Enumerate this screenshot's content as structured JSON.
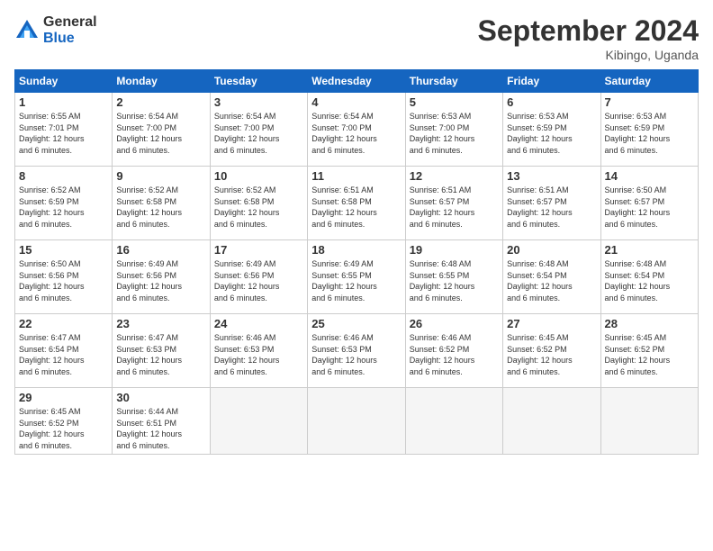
{
  "logo": {
    "general": "General",
    "blue": "Blue"
  },
  "title": "September 2024",
  "location": "Kibingo, Uganda",
  "days_of_week": [
    "Sunday",
    "Monday",
    "Tuesday",
    "Wednesday",
    "Thursday",
    "Friday",
    "Saturday"
  ],
  "weeks": [
    [
      {
        "day": "1",
        "sunrise": "6:55 AM",
        "sunset": "7:01 PM",
        "daylight": "12 hours and 6 minutes."
      },
      {
        "day": "2",
        "sunrise": "6:54 AM",
        "sunset": "7:00 PM",
        "daylight": "12 hours and 6 minutes."
      },
      {
        "day": "3",
        "sunrise": "6:54 AM",
        "sunset": "7:00 PM",
        "daylight": "12 hours and 6 minutes."
      },
      {
        "day": "4",
        "sunrise": "6:54 AM",
        "sunset": "7:00 PM",
        "daylight": "12 hours and 6 minutes."
      },
      {
        "day": "5",
        "sunrise": "6:53 AM",
        "sunset": "7:00 PM",
        "daylight": "12 hours and 6 minutes."
      },
      {
        "day": "6",
        "sunrise": "6:53 AM",
        "sunset": "6:59 PM",
        "daylight": "12 hours and 6 minutes."
      },
      {
        "day": "7",
        "sunrise": "6:53 AM",
        "sunset": "6:59 PM",
        "daylight": "12 hours and 6 minutes."
      }
    ],
    [
      {
        "day": "8",
        "sunrise": "6:52 AM",
        "sunset": "6:59 PM",
        "daylight": "12 hours and 6 minutes."
      },
      {
        "day": "9",
        "sunrise": "6:52 AM",
        "sunset": "6:58 PM",
        "daylight": "12 hours and 6 minutes."
      },
      {
        "day": "10",
        "sunrise": "6:52 AM",
        "sunset": "6:58 PM",
        "daylight": "12 hours and 6 minutes."
      },
      {
        "day": "11",
        "sunrise": "6:51 AM",
        "sunset": "6:58 PM",
        "daylight": "12 hours and 6 minutes."
      },
      {
        "day": "12",
        "sunrise": "6:51 AM",
        "sunset": "6:57 PM",
        "daylight": "12 hours and 6 minutes."
      },
      {
        "day": "13",
        "sunrise": "6:51 AM",
        "sunset": "6:57 PM",
        "daylight": "12 hours and 6 minutes."
      },
      {
        "day": "14",
        "sunrise": "6:50 AM",
        "sunset": "6:57 PM",
        "daylight": "12 hours and 6 minutes."
      }
    ],
    [
      {
        "day": "15",
        "sunrise": "6:50 AM",
        "sunset": "6:56 PM",
        "daylight": "12 hours and 6 minutes."
      },
      {
        "day": "16",
        "sunrise": "6:49 AM",
        "sunset": "6:56 PM",
        "daylight": "12 hours and 6 minutes."
      },
      {
        "day": "17",
        "sunrise": "6:49 AM",
        "sunset": "6:56 PM",
        "daylight": "12 hours and 6 minutes."
      },
      {
        "day": "18",
        "sunrise": "6:49 AM",
        "sunset": "6:55 PM",
        "daylight": "12 hours and 6 minutes."
      },
      {
        "day": "19",
        "sunrise": "6:48 AM",
        "sunset": "6:55 PM",
        "daylight": "12 hours and 6 minutes."
      },
      {
        "day": "20",
        "sunrise": "6:48 AM",
        "sunset": "6:54 PM",
        "daylight": "12 hours and 6 minutes."
      },
      {
        "day": "21",
        "sunrise": "6:48 AM",
        "sunset": "6:54 PM",
        "daylight": "12 hours and 6 minutes."
      }
    ],
    [
      {
        "day": "22",
        "sunrise": "6:47 AM",
        "sunset": "6:54 PM",
        "daylight": "12 hours and 6 minutes."
      },
      {
        "day": "23",
        "sunrise": "6:47 AM",
        "sunset": "6:53 PM",
        "daylight": "12 hours and 6 minutes."
      },
      {
        "day": "24",
        "sunrise": "6:46 AM",
        "sunset": "6:53 PM",
        "daylight": "12 hours and 6 minutes."
      },
      {
        "day": "25",
        "sunrise": "6:46 AM",
        "sunset": "6:53 PM",
        "daylight": "12 hours and 6 minutes."
      },
      {
        "day": "26",
        "sunrise": "6:46 AM",
        "sunset": "6:52 PM",
        "daylight": "12 hours and 6 minutes."
      },
      {
        "day": "27",
        "sunrise": "6:45 AM",
        "sunset": "6:52 PM",
        "daylight": "12 hours and 6 minutes."
      },
      {
        "day": "28",
        "sunrise": "6:45 AM",
        "sunset": "6:52 PM",
        "daylight": "12 hours and 6 minutes."
      }
    ],
    [
      {
        "day": "29",
        "sunrise": "6:45 AM",
        "sunset": "6:52 PM",
        "daylight": "12 hours and 6 minutes."
      },
      {
        "day": "30",
        "sunrise": "6:44 AM",
        "sunset": "6:51 PM",
        "daylight": "12 hours and 6 minutes."
      },
      null,
      null,
      null,
      null,
      null
    ]
  ],
  "labels": {
    "sunrise": "Sunrise:",
    "sunset": "Sunset:",
    "daylight": "Daylight:"
  }
}
